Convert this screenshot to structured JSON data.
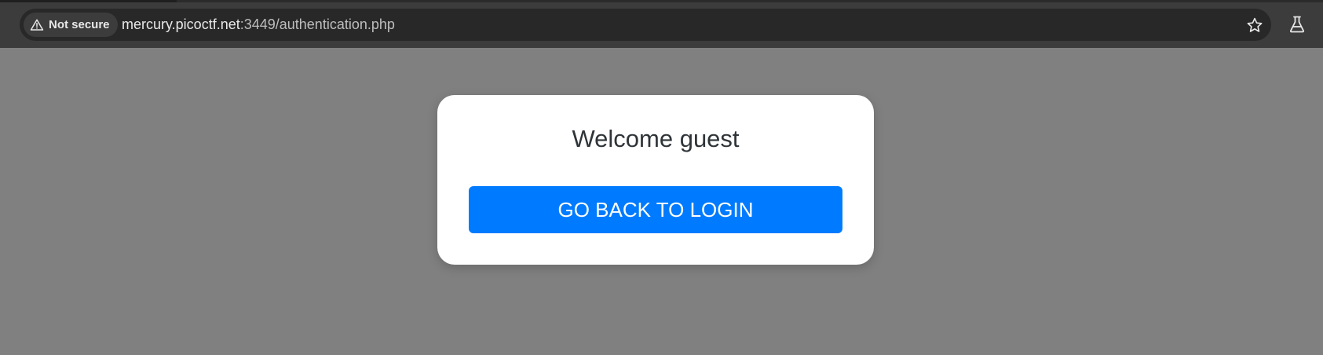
{
  "browser": {
    "security_label": "Not secure",
    "url_host": "mercury.picoctf.net",
    "url_path": ":3449/authentication.php",
    "icons": {
      "security": "warning-triangle-icon",
      "bookmark": "star-icon",
      "labs": "flask-icon"
    }
  },
  "page": {
    "welcome_text": "Welcome guest",
    "button_label": "GO BACK TO LOGIN",
    "colors": {
      "background": "#808080",
      "card": "#ffffff",
      "button": "#007bff",
      "button_text": "#ffffff"
    }
  }
}
